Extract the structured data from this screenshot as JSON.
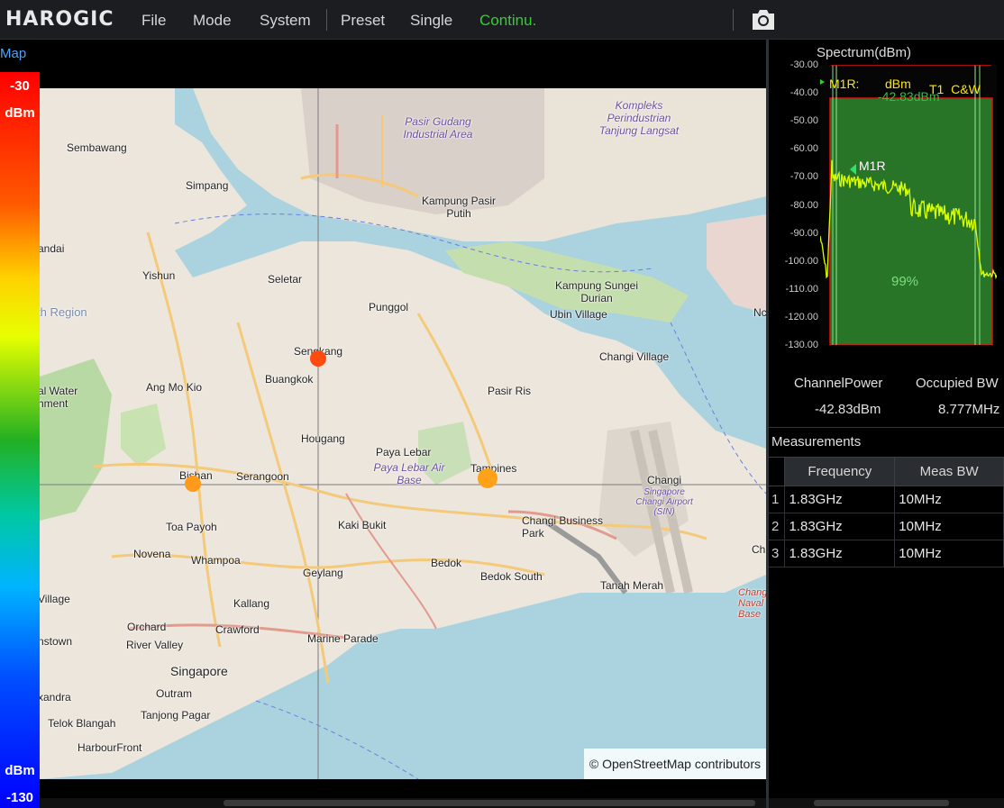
{
  "app": {
    "logo_text": "HAROGIC"
  },
  "menu": {
    "items": [
      "File",
      "Mode",
      "System",
      "Preset",
      "Single",
      "Continu."
    ],
    "active_color": "#2fd12f"
  },
  "map_panel": {
    "label": "Map",
    "colorbar": {
      "max_value": "-30",
      "min_value": "-130",
      "unit_top": "dBm",
      "unit_bottom": "dBm"
    },
    "attribution": "© OpenStreetMap contributors",
    "places": [
      "Sembawang",
      "Simpang",
      "Yishun",
      "Seletar",
      "Punggol",
      "Sengkang",
      "Buangkok",
      "Ang Mo Kio",
      "Hougang",
      "Paya Lebar",
      "Paya Lebar Air Base",
      "Tampines",
      "Bishan",
      "Serangoon",
      "Toa Payoh",
      "Novena",
      "Whampoa",
      "Kaki Bukit",
      "Geylang",
      "Bedok",
      "Bedok South",
      "Changi Business Park",
      "Changi",
      "Singapore Changi Airport (SIN)",
      "Changi Village",
      "Pasir Ris",
      "Tanah Merah",
      "Kallang",
      "Crawford",
      "Orchard",
      "River Valley",
      "Singapore",
      "Outram",
      "Tanjong Pagar",
      "Telok Blangah",
      "HarbourFront",
      "Marine Parade",
      "Kompleks Perindustrian Tanjung Langsat",
      "Pasir Gudang Industrial Area",
      "Kampung Pasir Putih",
      "Kampung Sungei Durian",
      "Ubin Village",
      "Changi Naval Base",
      "andai",
      "th Region",
      "al Water hment",
      "Village",
      "nstown",
      "xandra",
      "Ch",
      "Nc"
    ],
    "markers": [
      {
        "name": "Sengkang",
        "color": "#ff4a10"
      },
      {
        "name": "Bishan",
        "color": "#ff9a1a"
      },
      {
        "name": "Tampines",
        "color": "#ffa21a"
      }
    ]
  },
  "spectrum": {
    "title": "Spectrum(dBm)",
    "y_ticks": [
      "-30.00",
      "-40.00",
      "-50.00",
      "-60.00",
      "-70.00",
      "-80.00",
      "-90.00",
      "-100.00",
      "-110.00",
      "-120.00",
      "-130.00"
    ],
    "marker_readout_label": "M1R:",
    "marker_readout_value": "dBm",
    "marker_readout_overlap": "-42.83dBm",
    "trace_label": "T1  C&W",
    "marker_tag": "M1R",
    "occupied_percent": "99%",
    "trace_color": "#d8ff00",
    "band_color": "#2f8a2f"
  },
  "channel_power": {
    "label": "ChannelPower",
    "value": "-42.83dBm"
  },
  "occupied_bw": {
    "label": "Occupied BW",
    "value": "8.777MHz"
  },
  "measurements": {
    "title": "Measurements",
    "columns": [
      "Frequency",
      "Meas BW"
    ],
    "rows": [
      {
        "index": "1",
        "frequency": "1.83GHz",
        "meas_bw": "10MHz"
      },
      {
        "index": "2",
        "frequency": "1.83GHz",
        "meas_bw": "10MHz"
      },
      {
        "index": "3",
        "frequency": "1.83GHz",
        "meas_bw": "10MHz"
      }
    ]
  }
}
